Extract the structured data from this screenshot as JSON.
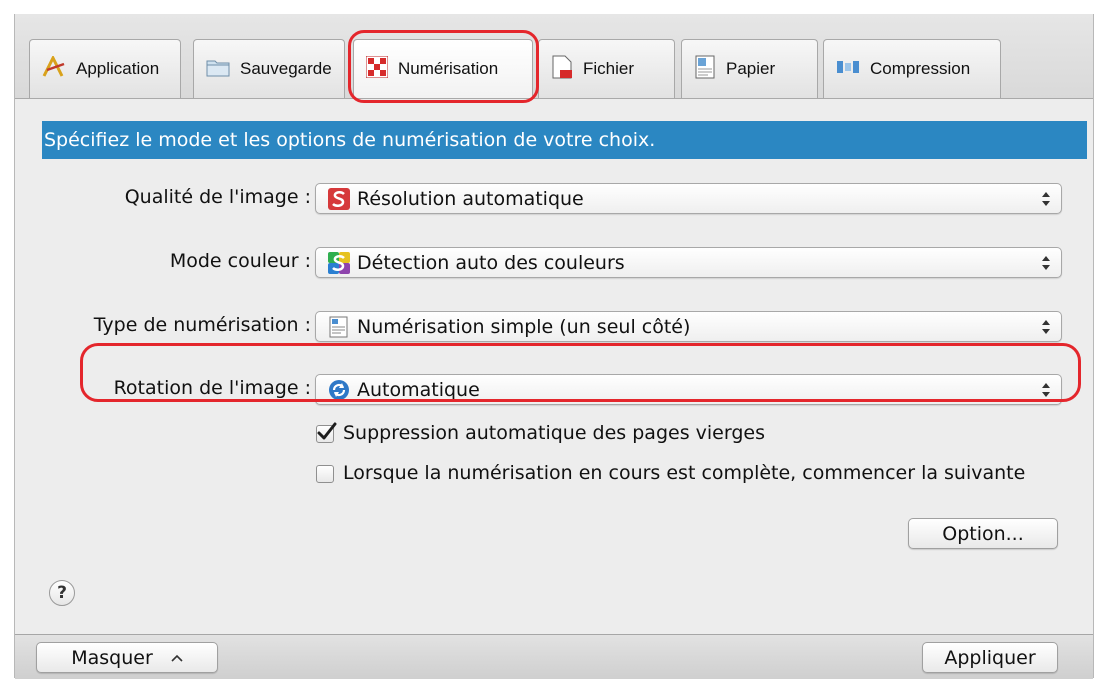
{
  "tabs": [
    {
      "label": "Application",
      "icon": "application-icon"
    },
    {
      "label": "Sauvegarde",
      "icon": "folder-icon"
    },
    {
      "label": "Numérisation",
      "icon": "scan-icon",
      "active": true
    },
    {
      "label": "Fichier",
      "icon": "file-icon"
    },
    {
      "label": "Papier",
      "icon": "paper-icon"
    },
    {
      "label": "Compression",
      "icon": "compression-icon"
    }
  ],
  "banner": "Spécifiez le mode et les options de numérisation de votre choix.",
  "settings": {
    "quality": {
      "label": "Qualité de l'image :",
      "value": "Résolution automatique",
      "icon": "scansnap-red-icon"
    },
    "color_mode": {
      "label": "Mode couleur :",
      "value": "Détection auto des couleurs",
      "icon": "scansnap-color-icon"
    },
    "scan_type": {
      "label": "Type de numérisation :",
      "value": "Numérisation simple (un seul côté)",
      "icon": "single-side-icon"
    },
    "rotation": {
      "label": "Rotation de l'image :",
      "value": "Automatique",
      "icon": "rotate-icon"
    }
  },
  "checkboxes": {
    "blank_page_removal": {
      "label": "Suppression automatique des pages vierges",
      "checked": true
    },
    "continuous_scan": {
      "label": "Lorsque la numérisation en cours est complète, commencer la suivante",
      "checked": false
    }
  },
  "buttons": {
    "option": "Option...",
    "hide": "Masquer",
    "apply": "Appliquer",
    "help": "?"
  },
  "colors": {
    "banner": "#2b87c2",
    "highlight": "#e4262c"
  }
}
